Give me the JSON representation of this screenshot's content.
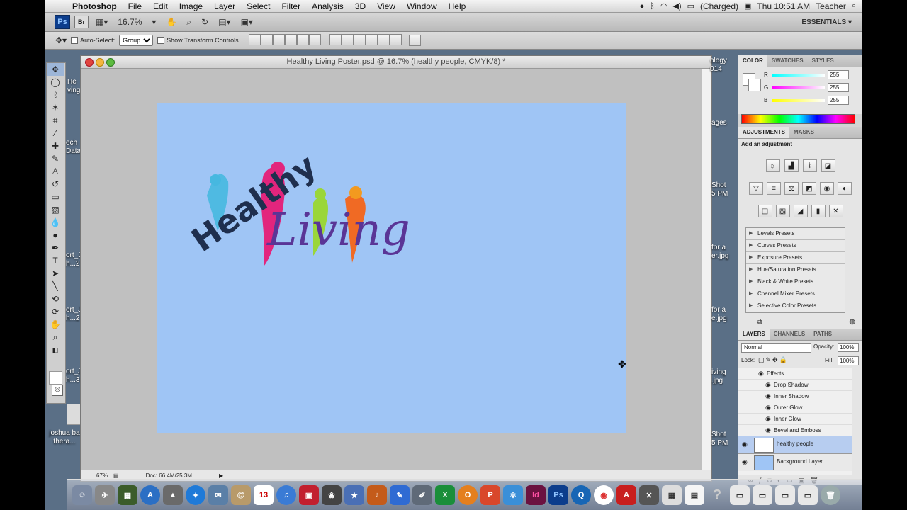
{
  "menubar": {
    "app_name": "Photoshop",
    "items": [
      "File",
      "Edit",
      "Image",
      "Layer",
      "Select",
      "Filter",
      "Analysis",
      "3D",
      "View",
      "Window",
      "Help"
    ],
    "battery": "(Charged)",
    "clock": "Thu 10:51 AM",
    "user": "Teacher"
  },
  "appbar": {
    "ps_badge": "Ps",
    "br_badge": "Br",
    "zoom": "16.7%",
    "workspace": "ESSENTIALS ▾"
  },
  "options": {
    "auto_select_label": "Auto-Select:",
    "auto_select_value": "Group",
    "show_transform_label": "Show Transform Controls"
  },
  "document": {
    "title": "Healthy Living Poster.psd @ 16.7% (healthy people, CMYK/8) *",
    "status_zoom": "67%",
    "status_doc": "Doc: 66.4M/25.3M",
    "logo_word1": "Healthy",
    "logo_word2": "Living",
    "canvas_color": "#9fc5f5"
  },
  "desktop": {
    "labels_left": [
      "He",
      "ving",
      "ech",
      "Data",
      "ort_J",
      "h...2",
      "ort_J",
      "h...2",
      "ort_J",
      "h...3",
      "joshua ba",
      "thera..."
    ],
    "labels_right": [
      "ology",
      "014",
      "ages",
      "Shot",
      "5 PM",
      "for a",
      "er.jpg",
      "for a",
      "e.jpg",
      "iving",
      ".jpg",
      "Shot",
      "5 PM"
    ]
  },
  "color_panel": {
    "tabs": [
      "COLOR",
      "SWATCHES",
      "STYLES"
    ],
    "channels": [
      {
        "label": "R",
        "value": "255"
      },
      {
        "label": "G",
        "value": "255"
      },
      {
        "label": "B",
        "value": "255"
      }
    ]
  },
  "adjustments_panel": {
    "tabs": [
      "ADJUSTMENTS",
      "MASKS"
    ],
    "heading": "Add an adjustment",
    "presets": [
      "Levels Presets",
      "Curves Presets",
      "Exposure Presets",
      "Hue/Saturation Presets",
      "Black & White Presets",
      "Channel Mixer Presets",
      "Selective Color Presets"
    ]
  },
  "layers_panel": {
    "tabs": [
      "LAYERS",
      "CHANNELS",
      "PATHS"
    ],
    "blend_mode": "Normal",
    "opacity_label": "Opacity:",
    "opacity_value": "100%",
    "lock_label": "Lock:",
    "fill_label": "Fill:",
    "fill_value": "100%",
    "effects_label": "Effects",
    "effects": [
      "Drop Shadow",
      "Inner Shadow",
      "Outer Glow",
      "Inner Glow",
      "Bevel and Emboss"
    ],
    "layers": [
      "healthy people",
      "Background Layer"
    ]
  },
  "dock": {
    "calendar_day": "13",
    "indesign": "Id",
    "photoshop": "Ps"
  }
}
